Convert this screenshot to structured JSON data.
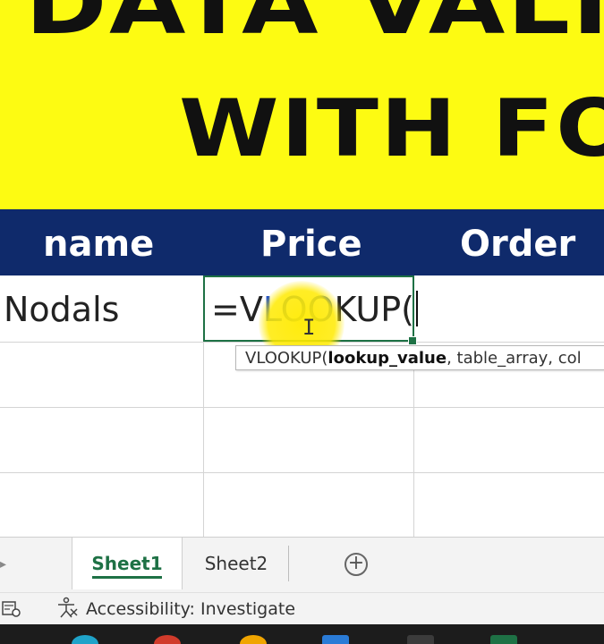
{
  "banner": {
    "line1": "DATA VALIDA",
    "line2": "WITH FOR"
  },
  "header": {
    "col1": "name",
    "col2": "Price",
    "col3": "Order"
  },
  "grid": {
    "cell_a2": "Nodals",
    "formula_prefix": "=V",
    "formula_highlight": "LOO",
    "formula_suffix": "KUP("
  },
  "tooltip": {
    "fn": "VLOOKUP(",
    "arg1": "lookup_value",
    "rest": ", table_array, col"
  },
  "sheet_tabs": {
    "tab1": "Sheet1",
    "tab2": "Sheet2",
    "add": "+"
  },
  "status": {
    "accessibility": "Accessibility: Investigate"
  },
  "colors": {
    "banner": "#fdfb12",
    "header": "#0f2a6b",
    "accent": "#1e7145",
    "formula_highlight": "#1f4fc6"
  }
}
